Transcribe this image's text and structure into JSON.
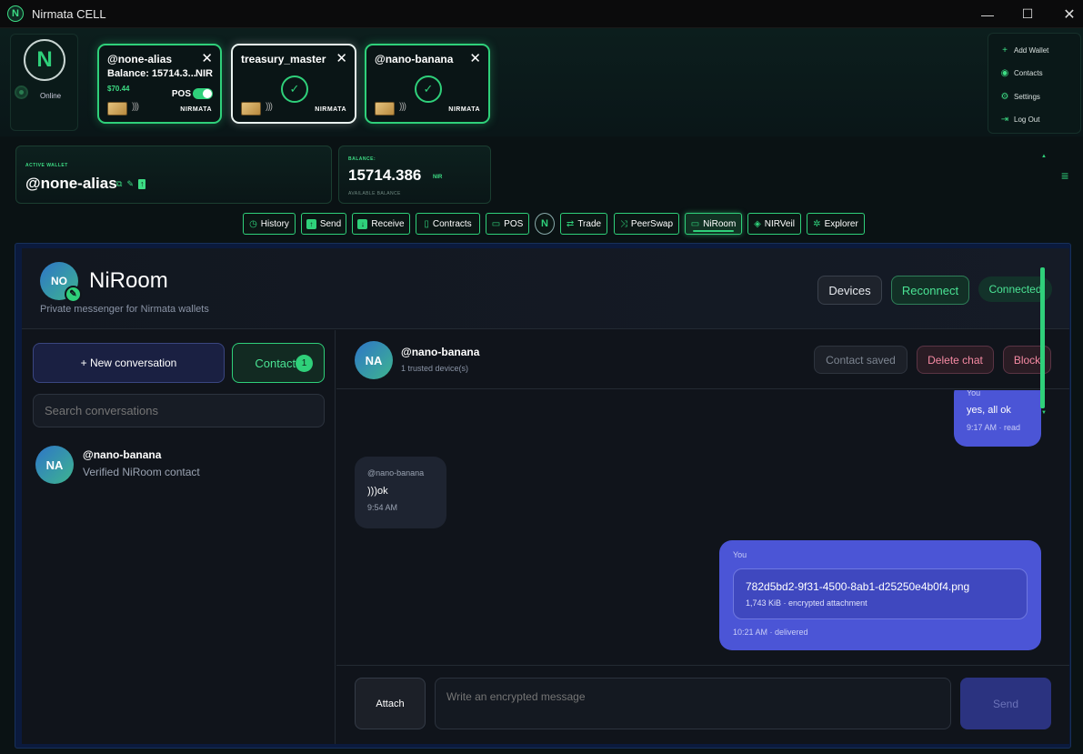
{
  "titlebar": {
    "title": "Nirmata CELL",
    "icon": "nirmata-logo-icon"
  },
  "node": {
    "status": "Online"
  },
  "wallet_cards": [
    {
      "name": "@none-alias",
      "balance": "Balance: 15714.3...",
      "unit": "NIR",
      "usd": "$70.44",
      "pos_label": "POS",
      "pos_enabled": true,
      "brand": "NIRMATA"
    },
    {
      "name": "treasury_master",
      "brand": "NIRMATA",
      "locked": true
    },
    {
      "name": "@nano-banana",
      "brand": "NIRMATA",
      "locked": true
    }
  ],
  "side_menu": {
    "add_wallet": "Add Wallet",
    "contacts": "Contacts",
    "settings": "Settings",
    "logout": "Log Out"
  },
  "active_wallet": {
    "caption": "ACTIVE WALLET",
    "name": "@none-alias"
  },
  "balance_panel": {
    "caption": "BALANCE:",
    "value": "15714.386",
    "unit": "NIR",
    "sub": "AVAILABLE BALANCE"
  },
  "nav": [
    "History",
    "Send",
    "Receive",
    "Contracts",
    "POS",
    "Trade",
    "PeerSwap",
    "NiRoom",
    "NIRVeil",
    "Explorer"
  ],
  "niroom": {
    "avatar": "NO",
    "title": "NiRoom",
    "subtitle": "Private messenger for Nirmata wallets",
    "devices": "Devices",
    "reconnect": "Reconnect",
    "status": "Connected",
    "new_conversation": "+ New conversation",
    "contacts": "Contacts",
    "contacts_count": "1",
    "search_placeholder": "Search conversations",
    "conversations": [
      {
        "avatar": "NA",
        "name": "@nano-banana",
        "sub": "Verified NiRoom contact"
      }
    ],
    "chat": {
      "avatar": "NA",
      "name": "@nano-banana",
      "devices": "1 trusted device(s)",
      "contact_saved": "Contact saved",
      "delete_chat": "Delete chat",
      "block": "Block",
      "messages": [
        {
          "from": "You",
          "text": "yes, all ok",
          "meta": "9:17 AM · read"
        },
        {
          "from": "@nano-banana",
          "text": ")))ok",
          "meta": "9:54 AM"
        },
        {
          "from": "You",
          "file": "782d5bd2-9f31-4500-8ab1-d25250e4b0f4.png",
          "file_meta": "1,743 KiB · encrypted attachment",
          "meta": "10:21 AM · delivered"
        }
      ],
      "attach": "Attach",
      "input_placeholder": "Write an encrypted message",
      "send": "Send"
    }
  },
  "colors": {
    "accent": "#2fd07a",
    "bubble_out": "#4b55d6",
    "panel": "#10141b"
  }
}
